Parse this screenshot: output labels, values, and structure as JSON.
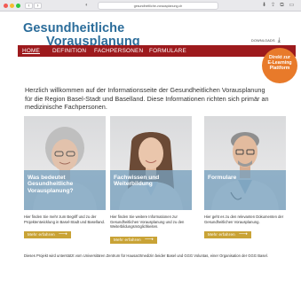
{
  "browser": {
    "back": "‹",
    "forward": "›",
    "shield": "◐",
    "url": "gesundheitliche-vorausplanung.ch",
    "icons": [
      "download-icon",
      "share-icon",
      "tabs-icon",
      "sidebar-icon"
    ]
  },
  "header": {
    "logo_line1": "Gesundheitliche",
    "logo_line2": "Vorausplanung",
    "downloads_label": "DOWNLOADS"
  },
  "nav": {
    "items": [
      "HOME",
      "DEFINITION",
      "FACHPERSONEN",
      "FORMULARE"
    ]
  },
  "badge": {
    "line1": "Direkt zur",
    "line2": "E-Learning",
    "line3": "Plattform"
  },
  "intro": {
    "text": "Herzlich willkommen auf der Informationsseite der Gesundheitlichen Vorausplanung für die Region Basel-Stadt und Baselland. Diese Informationen richten sich primär an medizinische Fachpersonen."
  },
  "cards": [
    {
      "title": "Was bedeutet Gesundheitliche Vorausplanung?",
      "description": "Hier finden Sie mehr zum Begriff und zu der Projektentwicklung in Basel-Stadt und Baselland.",
      "button": "Mehr erfahren"
    },
    {
      "title": "Fachwissen und Weiterbildung",
      "description": "Hier finden Sie weitere Informationen zur Gesundheitlichen Vorausplanung und zu den Weiterbildungsmöglichkeiten.",
      "button": "Mehr erfahren"
    },
    {
      "title": "Formulare",
      "description": "Hier geht es zu den relevanten Dokumenten der Gesundheitlichen Vorausplanung.",
      "button": "Mehr erfahren"
    }
  ],
  "footnote": {
    "text": "Dieses Projekt wird unterstützt vom Universitären Zentrum für Hausarztmedizin beider Basel und GGG Voluntas, einer Organisation der GGG Basel."
  },
  "colors": {
    "brand_blue": "#2a6c9a",
    "nav_red": "#9d1a1d",
    "badge_orange": "#e87a2a",
    "button_gold": "#c9a336",
    "overlay_blue": "#77a0be"
  }
}
